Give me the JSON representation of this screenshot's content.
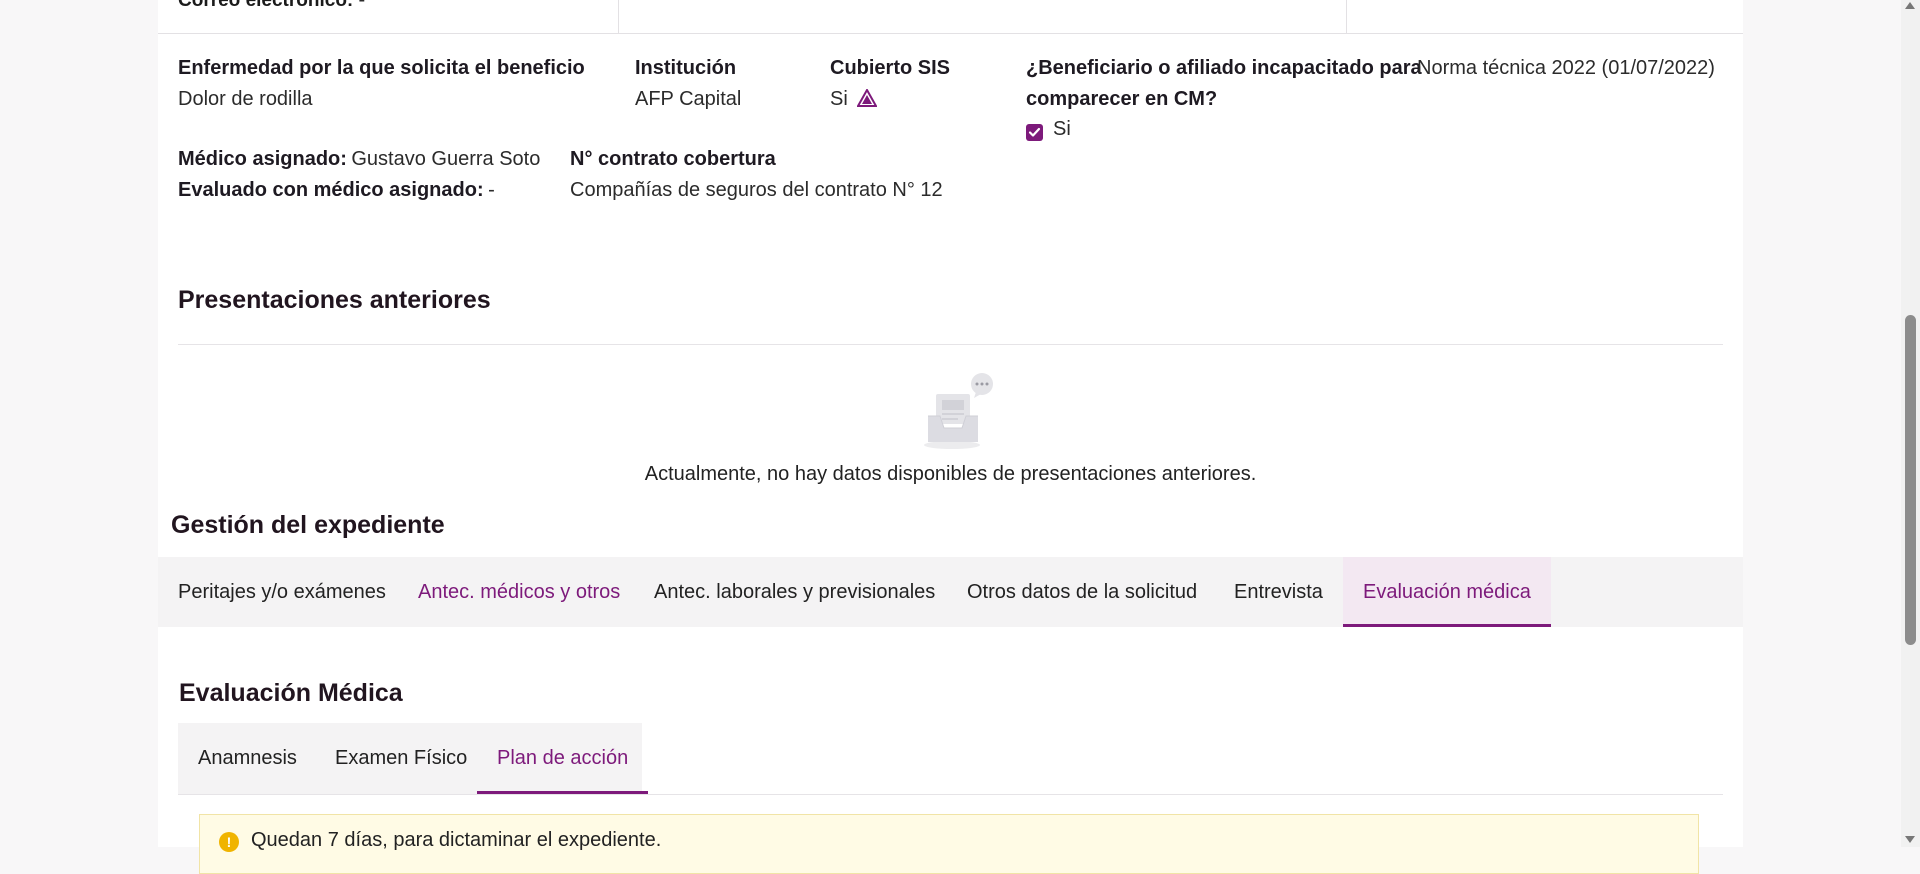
{
  "summary": {
    "email_label": "Correo electrónico:",
    "email_value": "-",
    "disease_label": "Enfermedad por la que solicita el beneficio",
    "disease_value": "Dolor de rodilla",
    "institution_label": "Institución",
    "institution_value": "AFP Capital",
    "sis_label": "Cubierto SIS",
    "sis_value": "Si",
    "incapacitated_label_line1": "¿Beneficiario o afiliado incapacitado para",
    "incapacitated_label_line2": "comparecer en CM?",
    "incapacitated_value": "Si",
    "incapacitated_checked": true,
    "norma": "Norma técnica 2022 (01/07/2022)",
    "doctor_label": "Médico asignado:",
    "doctor_value": "Gustavo Guerra Soto",
    "evaluated_label": "Evaluado con médico asignado:",
    "evaluated_value": "-",
    "contract_label": "N° contrato cobertura",
    "contract_value": "Compañías de seguros del contrato N° 12"
  },
  "previous": {
    "title": "Presentaciones anteriores",
    "empty_message": "Actualmente, no hay datos disponibles de presentaciones anteriores."
  },
  "gestion": {
    "title": "Gestión del expediente",
    "tabs": [
      {
        "label": "Peritajes y/o exámenes"
      },
      {
        "label": "Antec. médicos y otros"
      },
      {
        "label": "Antec. laborales y previsionales"
      },
      {
        "label": "Otros datos de la solicitud"
      },
      {
        "label": "Entrevista"
      },
      {
        "label": "Evaluación médica"
      }
    ],
    "active_tab": "Evaluación médica"
  },
  "evaluation": {
    "title": "Evaluación Médica",
    "subtabs": [
      {
        "label": "Anamnesis"
      },
      {
        "label": "Examen Físico"
      },
      {
        "label": "Plan de acción"
      }
    ],
    "active_subtab": "Plan de acción",
    "alert_icon": "!",
    "alert_text": "Quedan 7 días, para dictaminar el expediente."
  },
  "colors": {
    "accent": "#7d1a7b",
    "warning": "#f0b400",
    "alert_bg": "#fffbe5"
  },
  "icons": {
    "warning": "warning-triangle-icon",
    "empty": "empty-inbox-icon",
    "alert": "alert-circle-icon",
    "check": "check-icon"
  }
}
